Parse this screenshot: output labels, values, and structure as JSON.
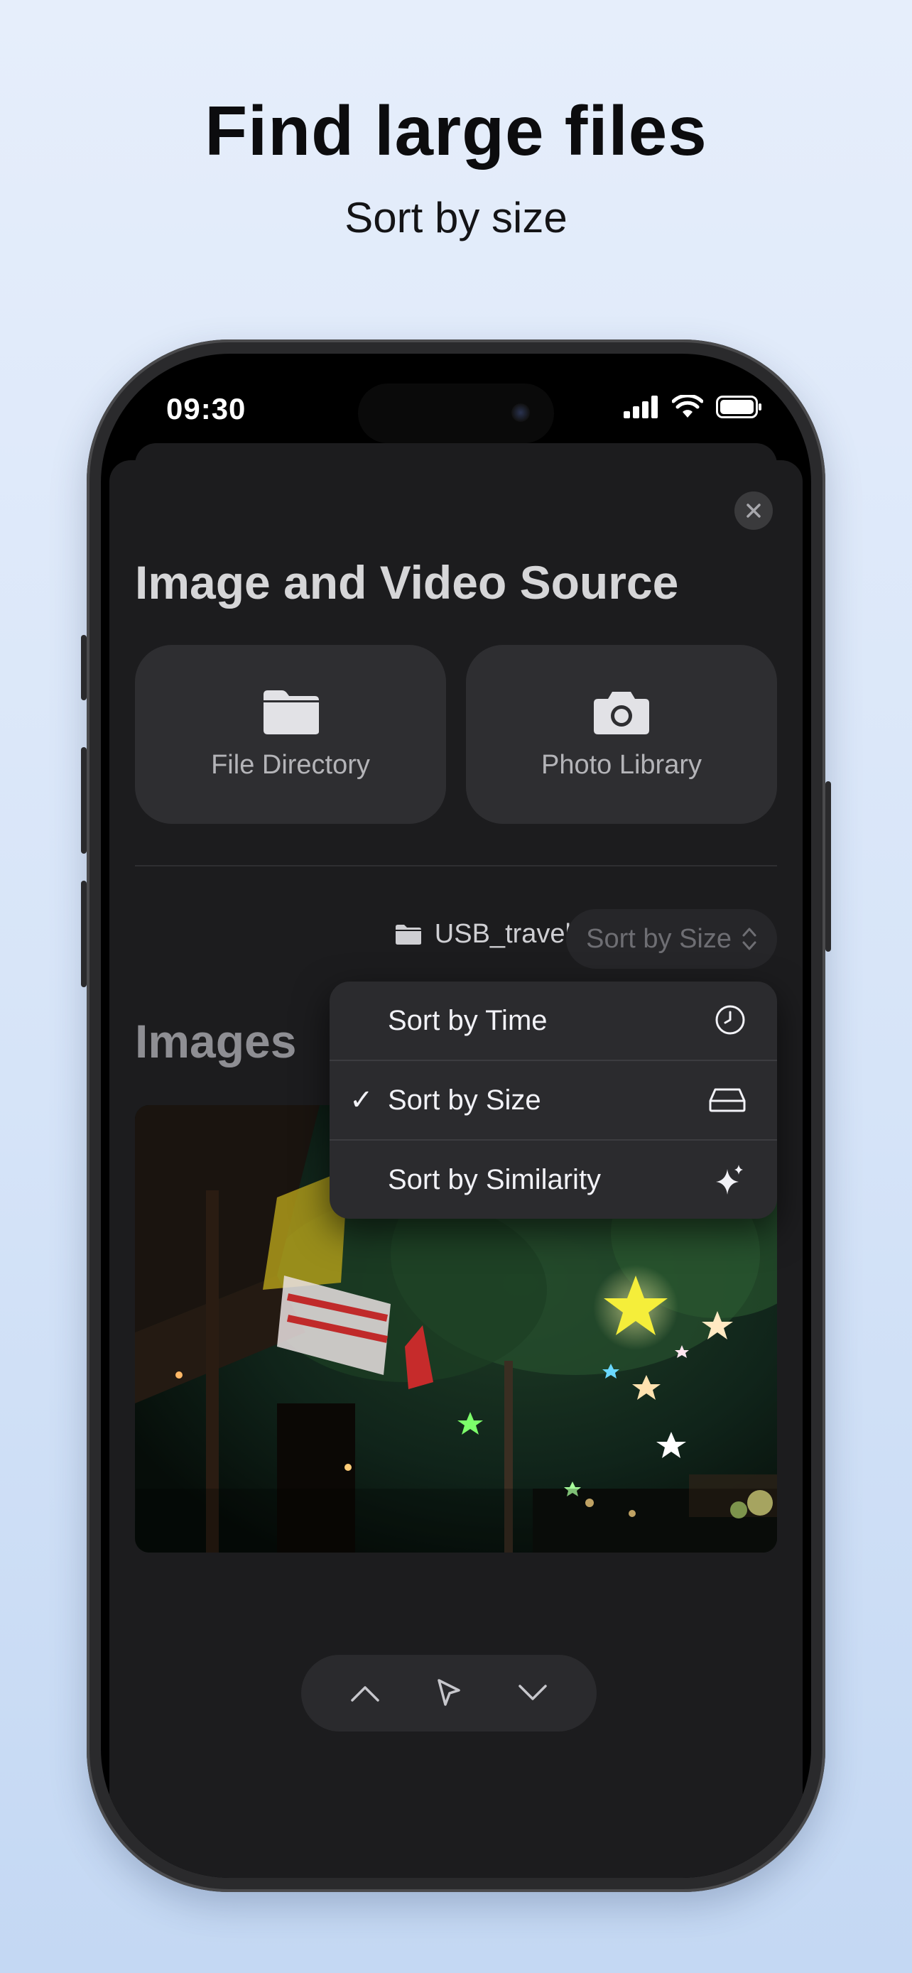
{
  "promo": {
    "headline": "Find large files",
    "subheadline": "Sort by size"
  },
  "status_bar": {
    "time": "09:30"
  },
  "sheet": {
    "title": "Image and Video Source",
    "sources": [
      {
        "label": "File Directory",
        "icon": "folder-icon"
      },
      {
        "label": "Photo Library",
        "icon": "camera-icon"
      }
    ]
  },
  "toolbar": {
    "folder_name": "USB_travel",
    "sort_label": "Sort by Size"
  },
  "section": {
    "heading": "Images"
  },
  "sort_menu": {
    "items": [
      {
        "label": "Sort by Time",
        "icon": "clock-icon",
        "checked": false
      },
      {
        "label": "Sort by Size",
        "icon": "drive-icon",
        "checked": true
      },
      {
        "label": "Sort by Similarity",
        "icon": "sparkles-icon",
        "checked": false
      }
    ],
    "check_glyph": "✓"
  },
  "bottom_nav": {
    "items": [
      "chevron-up-icon",
      "pointer-icon",
      "chevron-down-icon"
    ]
  }
}
